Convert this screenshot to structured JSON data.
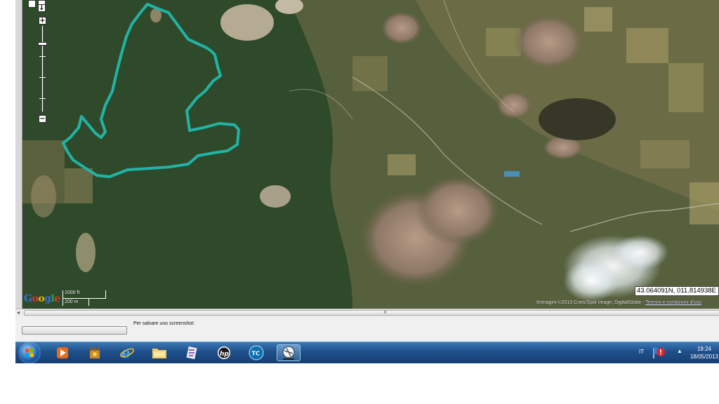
{
  "map": {
    "coordinates": "43.064091N, 011.814938E",
    "attribution": "Immagini ©2013 Cnes/Spot Image, DigitalGlobe - ",
    "terms_link": "Termini e condizioni d'uso",
    "google_logo": "Google",
    "scale_imperial": "1000 ft",
    "scale_metric": "200 m",
    "track_color": "#21b3a6"
  },
  "zoom": {
    "plus": "+",
    "minus": "−",
    "level": 0.21
  },
  "scrollbar": {
    "left_arrow": "◂",
    "grip": "III"
  },
  "bottom": {
    "save_label": "Per salvare uno screenshot:"
  },
  "taskbar": {
    "items": [
      {
        "name": "media-player-icon",
        "glyph": "▶"
      },
      {
        "name": "game-icon",
        "glyph": "♜"
      },
      {
        "name": "internet-explorer-icon",
        "glyph": "e"
      },
      {
        "name": "file-explorer-icon",
        "glyph": "▤"
      },
      {
        "name": "app-icon",
        "glyph": "✎"
      },
      {
        "name": "hp-icon",
        "glyph": "hp"
      },
      {
        "name": "tc-icon",
        "glyph": "TC"
      },
      {
        "name": "gps-icon",
        "glyph": "◎"
      }
    ],
    "tray_language": "IT",
    "tray_expand": "▲",
    "time": "19:24",
    "date": "18/05/2013"
  }
}
